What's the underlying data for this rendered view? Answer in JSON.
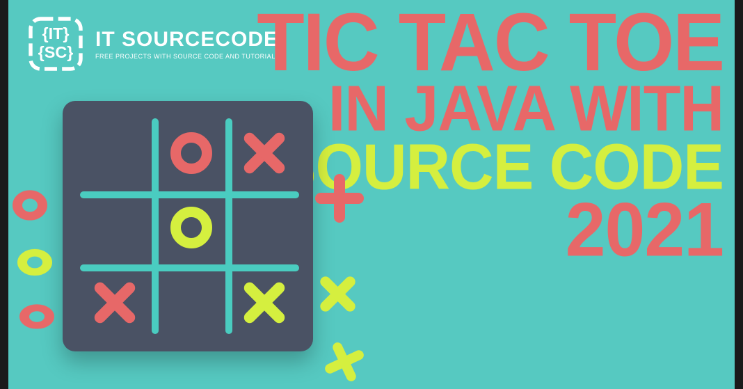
{
  "logo": {
    "name": "IT SOURCECODE",
    "tagline": "FREE PROJECTS WITH SOURCE CODE AND TUTORIALS"
  },
  "title": {
    "line1": "TIC TAC TOE",
    "line2": "IN JAVA WITH",
    "line3": "SOURCE CODE",
    "line4": "2021"
  },
  "board": {
    "cells": [
      [
        "",
        "O-red",
        "X-red"
      ],
      [
        "",
        "O-lime",
        ""
      ],
      [
        "X-red",
        "",
        "X-lime"
      ]
    ]
  },
  "colors": {
    "background": "#56c9c1",
    "accent_red": "#e76868",
    "accent_lime": "#d5ef3f",
    "board": "#4a5264",
    "grid": "#4accc0"
  }
}
